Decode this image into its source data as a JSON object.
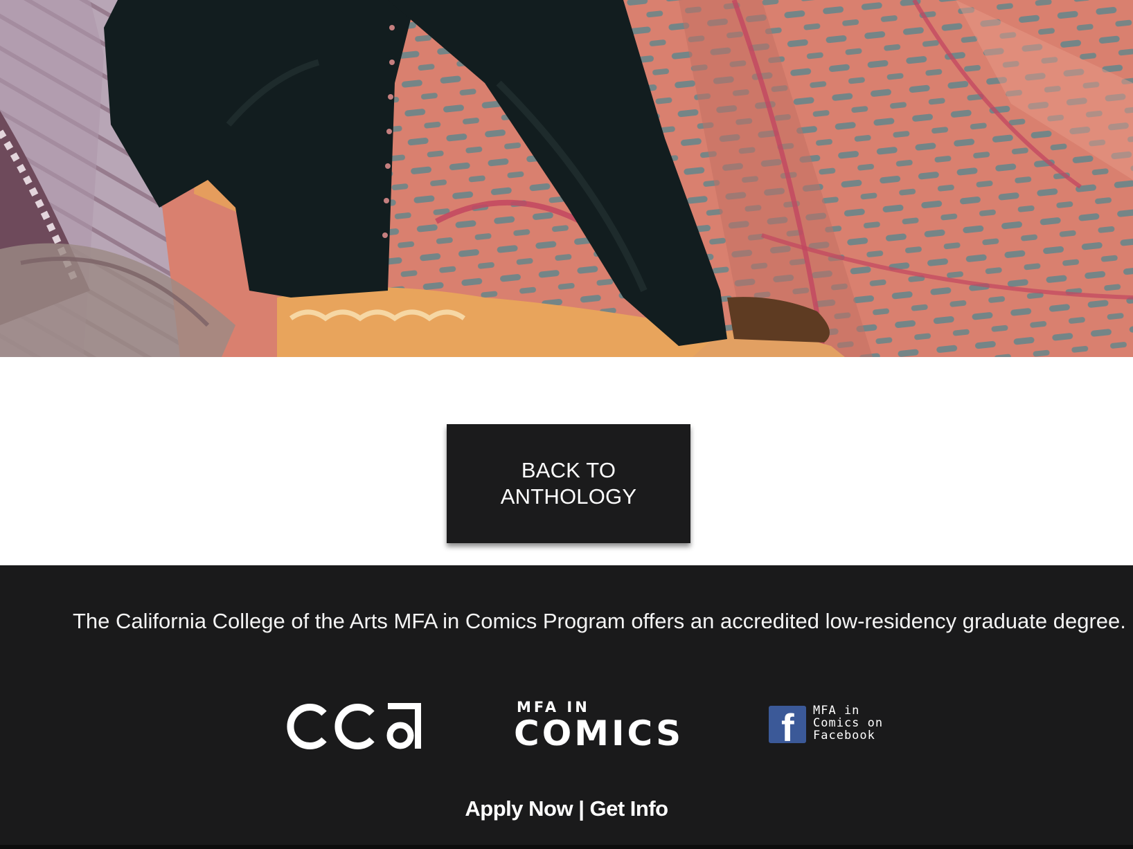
{
  "hero": {
    "image_name": "anthology-comic-artwork"
  },
  "back_button": {
    "line1": "BACK TO",
    "line2": "ANTHOLOGY"
  },
  "footer": {
    "tagline": "The California College of the Arts MFA in Comics Program offers an accredited low-residency graduate degree.",
    "logos": {
      "cca_text": "CCA",
      "mfa_small": "MFA IN",
      "mfa_big": "COMICS"
    },
    "facebook": {
      "badge_letter": "f",
      "line1": "MFA in",
      "line2": "Comics on",
      "line3": "Facebook"
    },
    "cta": {
      "apply": "Apply Now",
      "separator": " | ",
      "info": "Get Info"
    }
  },
  "colors": {
    "footer_bg": "#1a1a1b",
    "button_bg": "#1b1b1c",
    "facebook_blue": "#3b5998",
    "hero_salmon": "#d97e6f",
    "hero_lavender": "#b6a3b4"
  }
}
